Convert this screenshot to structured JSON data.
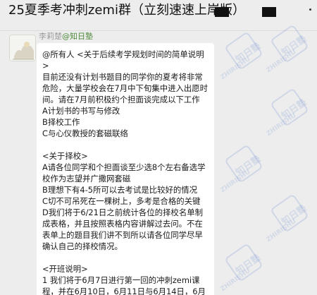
{
  "window": {
    "title": "25夏季考冲刺zemi群（立刻速速上岸版）"
  },
  "message": {
    "sender_name": "李莉楚",
    "sender_tag": "@知日塾",
    "lines": [
      "@所有人 <关于后续考学规划时间的简单说明",
      ">",
      "目前还没有计划书题目的同学你的夏考将非常",
      "危险，大量学校会在7月中下旬集中进入出愿时",
      "间。请在7月前积极约个担面谈完成以下工作",
      "A计划书的书写与修改",
      "B择校工作",
      "C与心仪教授的套磁联络",
      "",
      "<关于择校>",
      "A请各位同学和个担面谈至少选8个左右备选学",
      "校作为志望并广撒网套磁",
      "B理想下有4-5所可以去考试是比较好的情况",
      "C切不可吊死在一棵树上，多考是合格的关键",
      "D我们将于6/21日之前统计各位的择校名单制",
      "成表格，并且按照表格内容讲解过去问。不在",
      "表单上的题目我们讲不到所以请各位同学尽早",
      "确认自己的择校情况。",
      "",
      "<开班说明>",
      "1 我们将于6月7日进行第一回的冲刺zemi课",
      "程，并在6月10日，6月11日与6月14日，6月",
      "15日的下午16-18点进行4次的基础内容讲"
    ]
  },
  "watermark": {
    "text_cn": "知日塾",
    "text_en": "ZHIRISHU"
  }
}
